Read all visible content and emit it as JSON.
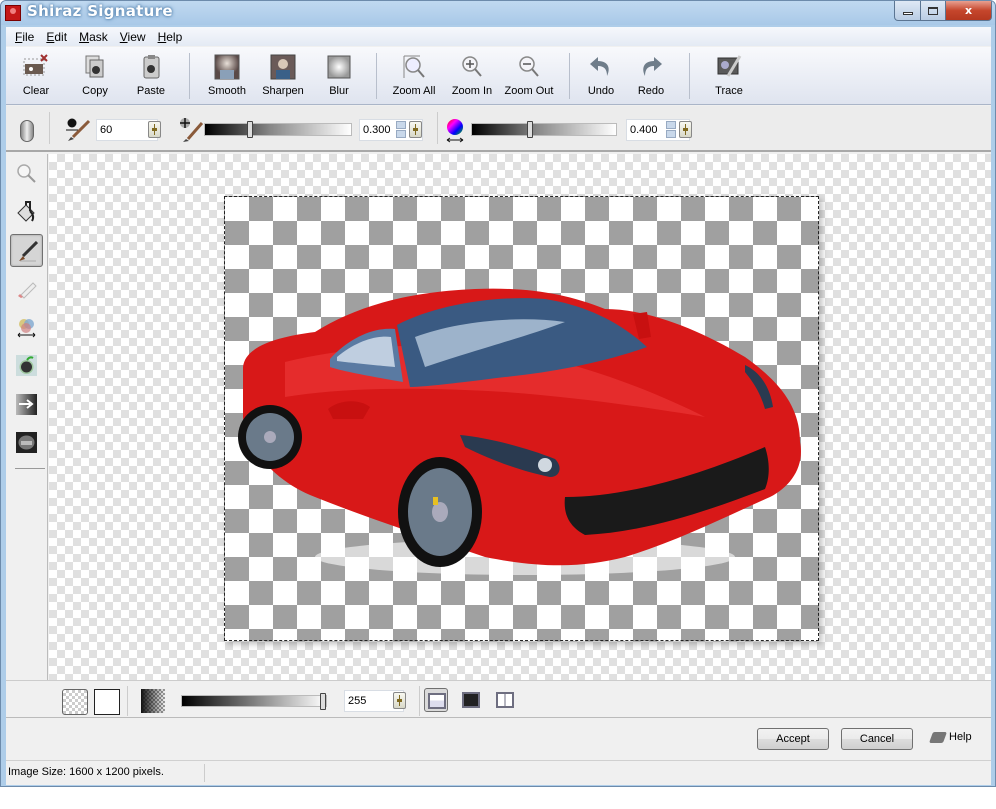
{
  "window": {
    "title": "Shiraz Signature",
    "controls": {
      "minimize": "minimize",
      "maximize": "maximize",
      "close": "x"
    }
  },
  "menu": [
    {
      "label": "File",
      "accel": "F"
    },
    {
      "label": "Edit",
      "accel": "E"
    },
    {
      "label": "Mask",
      "accel": "M"
    },
    {
      "label": "View",
      "accel": "V"
    },
    {
      "label": "Help",
      "accel": "H"
    }
  ],
  "toolbar": {
    "clear": "Clear",
    "copy": "Copy",
    "paste": "Paste",
    "smooth": "Smooth",
    "sharpen": "Sharpen",
    "blur": "Blur",
    "zoom_all": "Zoom All",
    "zoom_in": "Zoom In",
    "zoom_out": "Zoom Out",
    "undo": "Undo",
    "redo": "Redo",
    "trace": "Trace"
  },
  "options": {
    "brush_size": "60",
    "hardness_value": "0.300",
    "hardness_level": 0.3,
    "color_tolerance_value": "0.400",
    "color_tolerance_level": 0.4
  },
  "left_tools": [
    {
      "name": "zoom-tool",
      "icon": "magnifier-icon"
    },
    {
      "name": "fill-tool",
      "icon": "paint-bucket-icon"
    },
    {
      "name": "brush-tool",
      "icon": "brush-icon",
      "active": true
    },
    {
      "name": "eraser-tool",
      "icon": "eraser-icon"
    },
    {
      "name": "color-range-tool",
      "icon": "color-wheel-icon"
    },
    {
      "name": "object-mask-tool",
      "icon": "apple-mask-icon"
    },
    {
      "name": "gradient-mask-tool",
      "icon": "gradient-arrow-icon"
    },
    {
      "name": "image-tool",
      "icon": "image-thumbnail-icon"
    }
  ],
  "bottom": {
    "opacity_value": "255",
    "opacity_level": 1.0,
    "views": [
      "single-view",
      "preview-view",
      "split-view"
    ]
  },
  "actions": {
    "accept": "Accept",
    "cancel": "Cancel",
    "help": "Help"
  },
  "status": {
    "image_size": "Image Size: 1600 x 1200 pixels."
  },
  "canvas": {
    "subject": "red sports car cut-out on transparent background"
  },
  "colors": {
    "title_bar": "#aecde9",
    "close_button": "#c5462c",
    "car_red": "#d81818"
  }
}
